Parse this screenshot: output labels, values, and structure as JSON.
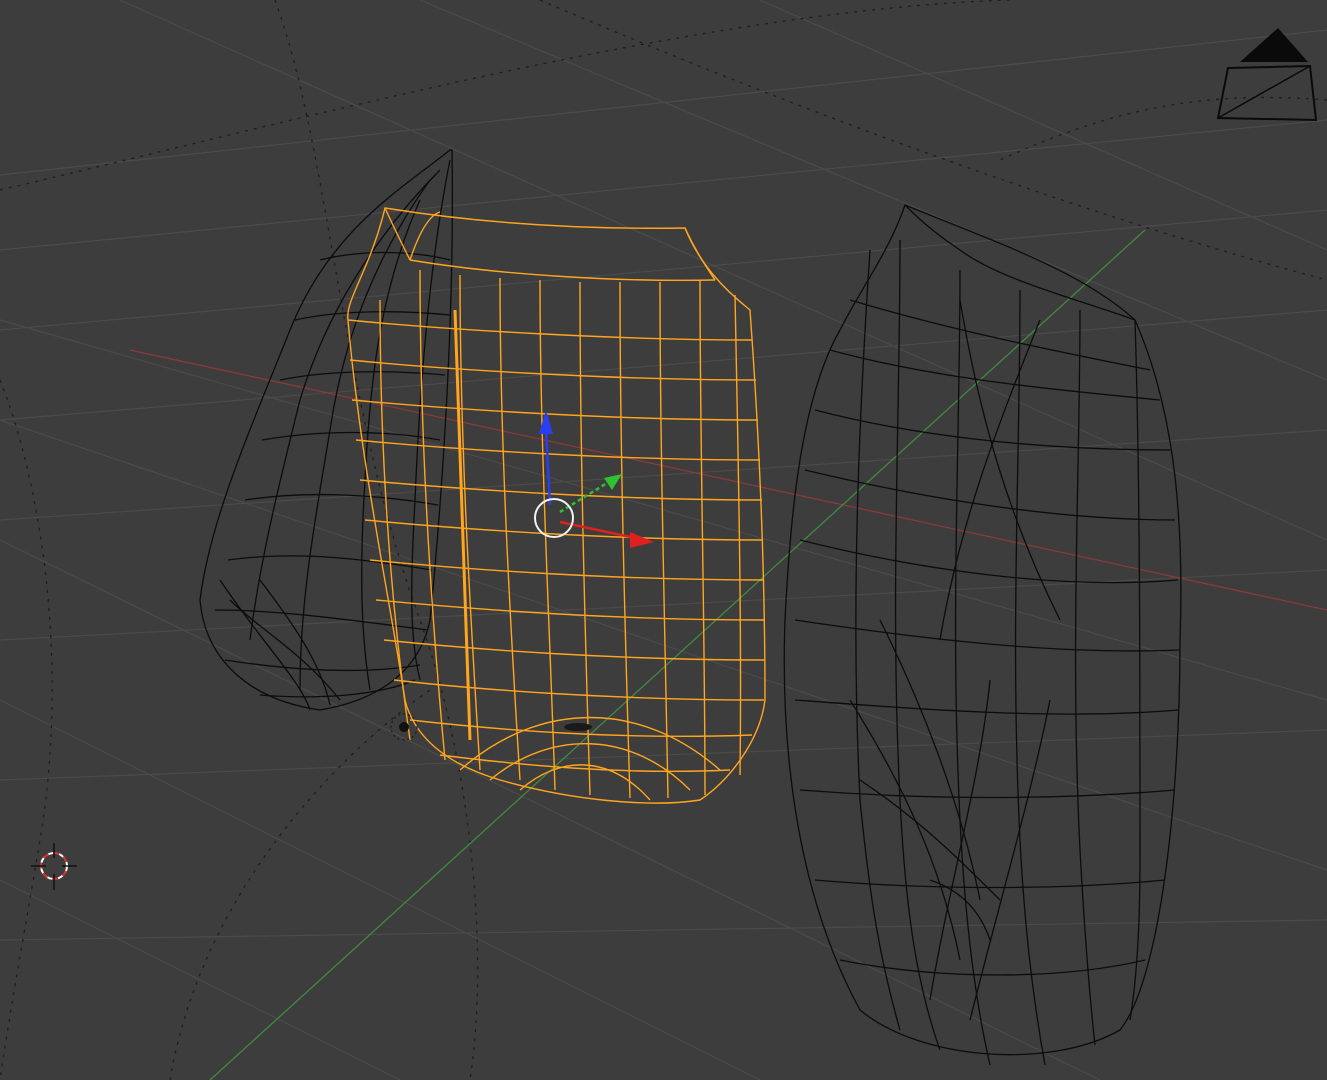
{
  "app": "3D Viewport",
  "viewport": {
    "shading_mode": "wireframe",
    "background_color": "#3d3d3d",
    "grid_color": "#4a4a4a",
    "x_axis_color": "#8a3a3a",
    "y_axis_color": "#3f8a3f"
  },
  "objects": [
    {
      "name": "left-mesh",
      "selected": false,
      "wire_color": "#0c0c0c"
    },
    {
      "name": "selected-mesh",
      "selected": true,
      "wire_color": "#ffa51f"
    },
    {
      "name": "right-mesh",
      "selected": false,
      "wire_color": "#0c0c0c"
    }
  ],
  "gizmo": {
    "type": "transform-manipulator",
    "z_color": "#2a3ff0",
    "y_color": "#30c030",
    "x_color": "#e02020",
    "center_color": "#f2f2f2"
  },
  "icons": [
    "camera-icon",
    "lamp-icon",
    "3d-cursor-icon",
    "manipulator-gizmo-icon"
  ]
}
